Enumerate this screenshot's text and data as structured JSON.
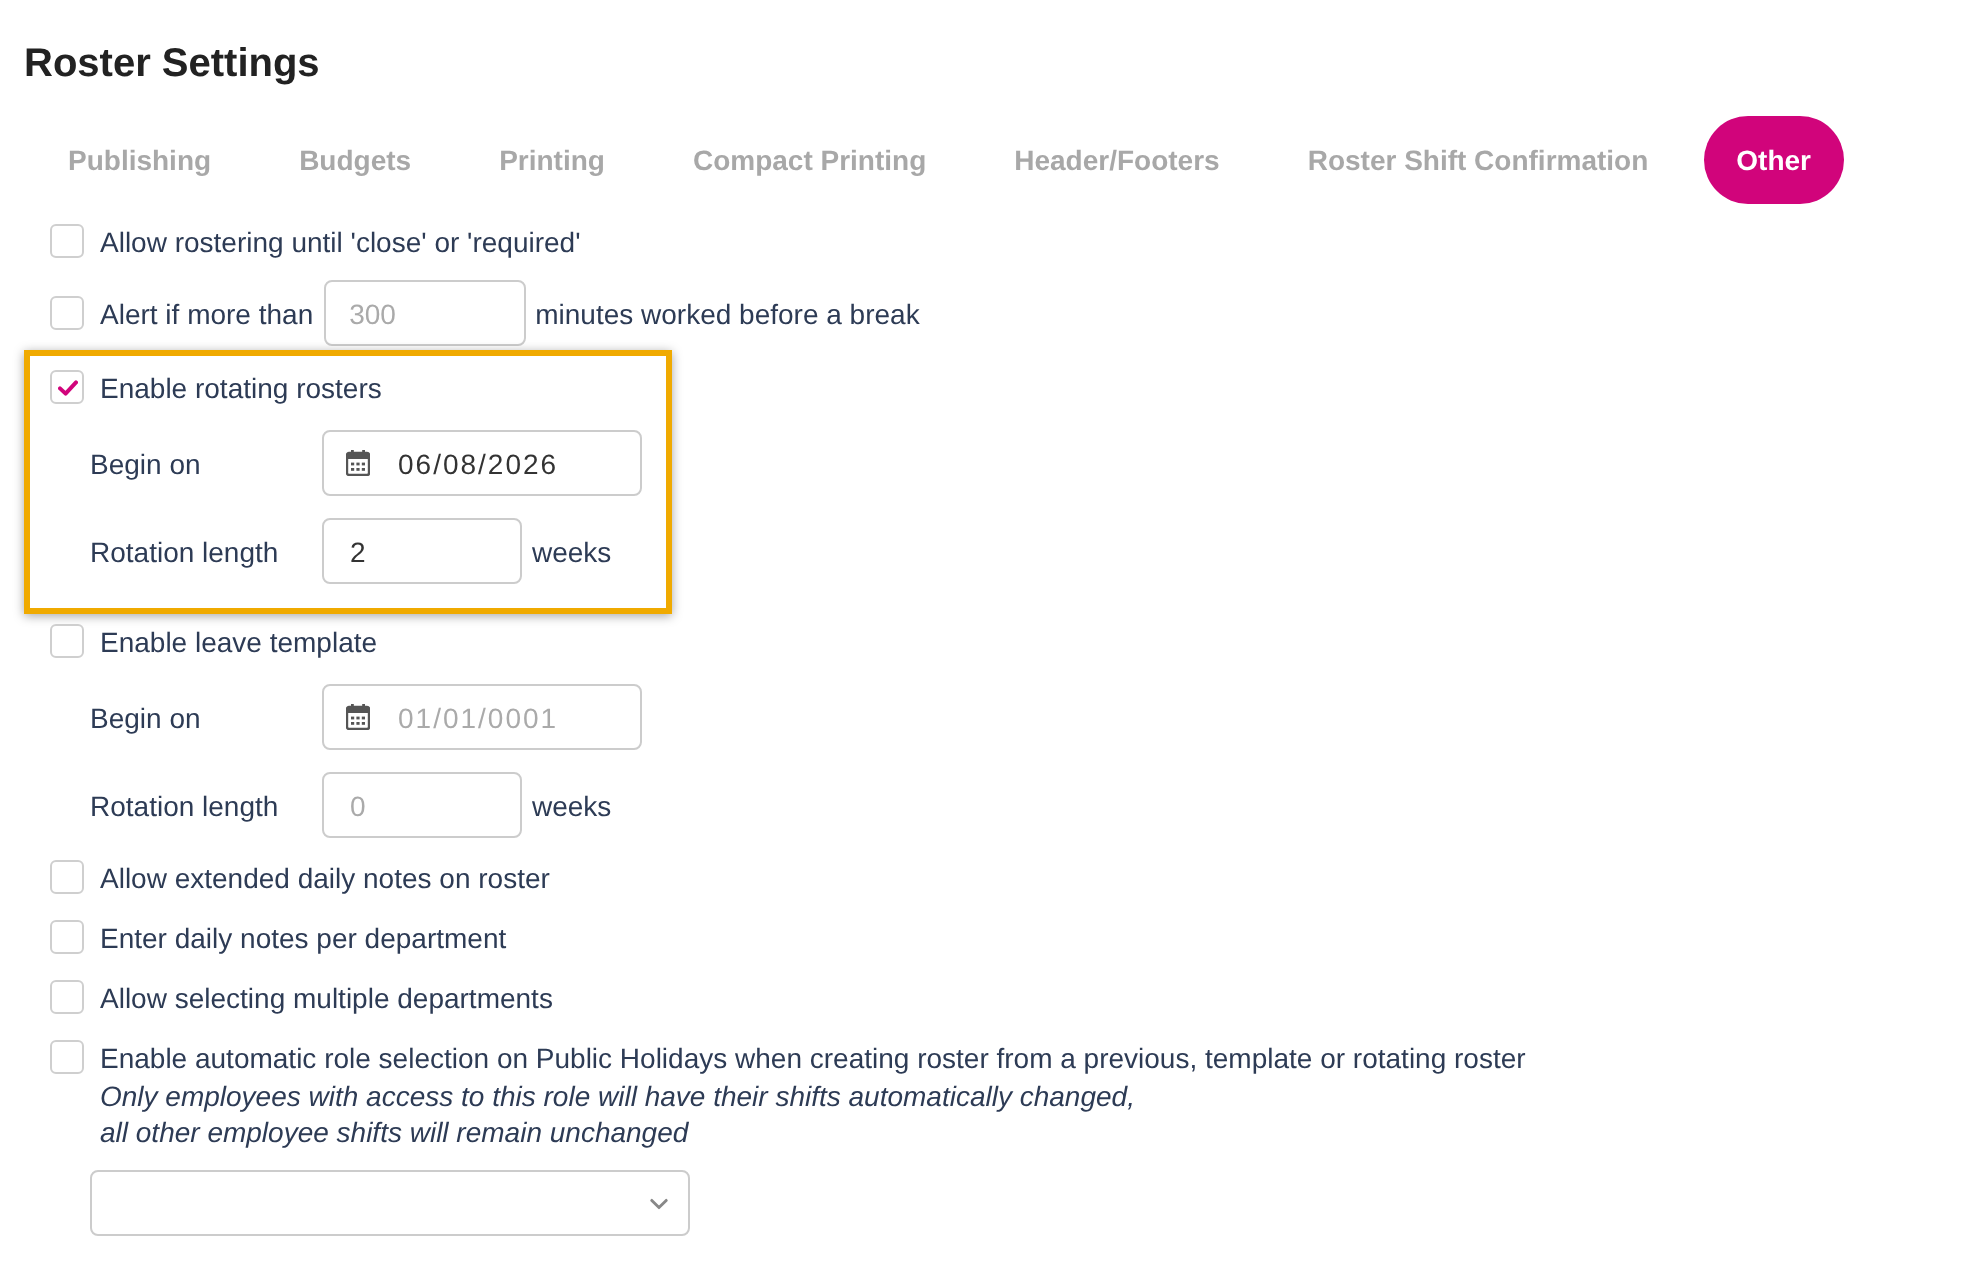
{
  "page": {
    "title": "Roster Settings"
  },
  "tabs": [
    {
      "label": "Publishing",
      "selected": false
    },
    {
      "label": "Budgets",
      "selected": false
    },
    {
      "label": "Printing",
      "selected": false
    },
    {
      "label": "Compact Printing",
      "selected": false
    },
    {
      "label": "Header/Footers",
      "selected": false
    },
    {
      "label": "Roster Shift Confirmation",
      "selected": false
    },
    {
      "label": "Other",
      "selected": true
    }
  ],
  "settings": [
    {
      "kind": "checkbox",
      "checked": false,
      "label": "Allow rostering until 'close' or 'required'"
    },
    {
      "kind": "inline_input",
      "checked": false,
      "label_before": "Alert if more than",
      "input": {
        "placeholder": "300"
      },
      "label_after": "minutes worked before a break"
    },
    {
      "kind": "group",
      "checked": true,
      "highlighted": true,
      "label": "Enable rotating rosters",
      "fields": [
        {
          "kind": "date",
          "label": "Begin on",
          "value": "06/08/2026",
          "disabled": false
        },
        {
          "kind": "number",
          "label": "Rotation length",
          "value": "2",
          "unit": "weeks",
          "disabled": false
        }
      ]
    },
    {
      "kind": "group",
      "checked": false,
      "highlighted": false,
      "label": "Enable leave template",
      "fields": [
        {
          "kind": "date",
          "label": "Begin on",
          "value": "01/01/0001",
          "disabled": true
        },
        {
          "kind": "number",
          "label": "Rotation length",
          "value": "0",
          "unit": "weeks",
          "disabled": true
        }
      ]
    },
    {
      "kind": "checkbox",
      "checked": false,
      "label": "Allow extended daily notes on roster"
    },
    {
      "kind": "checkbox",
      "checked": false,
      "label": "Enter daily notes per department"
    },
    {
      "kind": "checkbox",
      "checked": false,
      "label": "Allow selecting multiple departments"
    },
    {
      "kind": "note_select",
      "checked": false,
      "label": "Enable automatic role selection on Public Holidays when creating roster from a previous, template or rotating roster",
      "note_lines": [
        "Only employees with access to this role will have their shifts automatically changed,",
        "all other employee shifts will remain unchanged"
      ],
      "select": true
    }
  ]
}
